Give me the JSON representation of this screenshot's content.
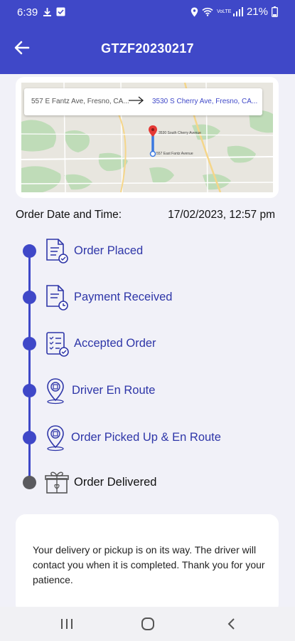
{
  "status_bar": {
    "time": "6:39",
    "battery": "21%",
    "network_label": "VoLTE"
  },
  "app_bar": {
    "title": "GTZF20230217",
    "back_icon": "arrow-left-icon"
  },
  "map": {
    "from_address": "557 E Fantz Ave, Fresno, CA...",
    "to_address": "3530 S Cherry Ave, Fresno, CA...",
    "pin_label_top": "3530 South Cherry Avenue",
    "pin_label_bottom": "557 East Fantz Avenue"
  },
  "order_date": {
    "label": "Order Date and Time:",
    "value": "17/02/2023, 12:57 pm"
  },
  "timeline": [
    {
      "label": "Order Placed",
      "icon": "document-check-icon",
      "done": true
    },
    {
      "label": "Payment Received",
      "icon": "document-clock-icon",
      "done": true
    },
    {
      "label": "Accepted Order",
      "icon": "checklist-icon",
      "done": true
    },
    {
      "label": "Driver En Route",
      "icon": "location-pin-icon",
      "done": true
    },
    {
      "label": "Order Picked Up & En Route",
      "icon": "location-pin-icon",
      "done": true
    },
    {
      "label": "Order Delivered",
      "icon": "gift-box-icon",
      "done": false
    }
  ],
  "message": {
    "text": "Your delivery or pickup is on its way. The driver will contact you when it is completed. Thank you for your patience."
  },
  "colors": {
    "primary": "#3F48C8",
    "label": "#2E36A8",
    "pending": "#5a5a5e",
    "background": "#F1F1F8"
  }
}
